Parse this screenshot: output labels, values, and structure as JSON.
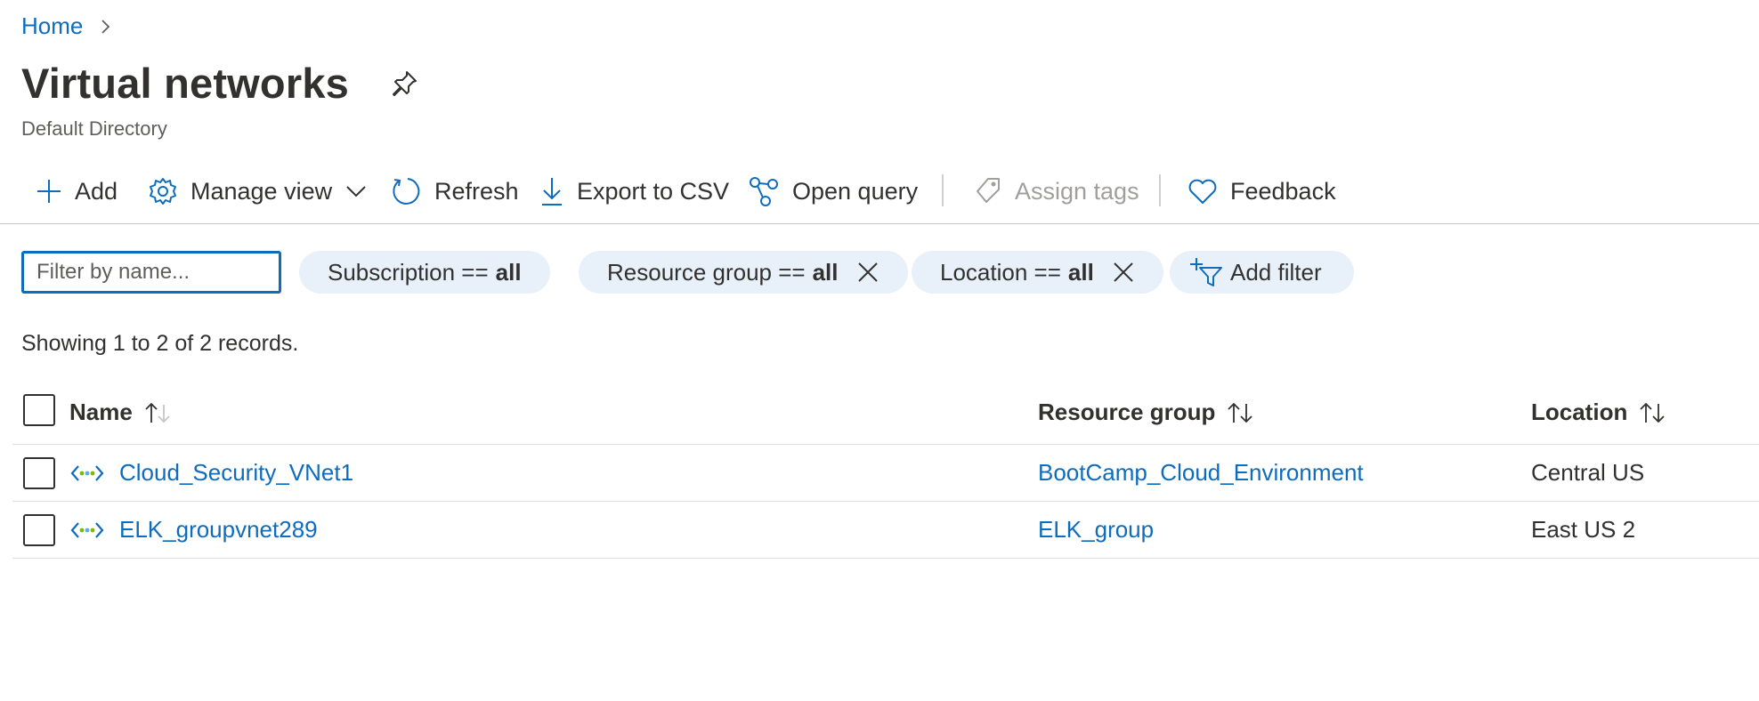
{
  "breadcrumb": {
    "home": "Home"
  },
  "page": {
    "title": "Virtual networks",
    "subtitle": "Default Directory"
  },
  "toolbar": {
    "add": "Add",
    "manage_view": "Manage view",
    "refresh": "Refresh",
    "export_csv": "Export to CSV",
    "open_query": "Open query",
    "assign_tags": "Assign tags",
    "feedback": "Feedback"
  },
  "filters": {
    "search_placeholder": "Filter by name...",
    "subscription_label": "Subscription ==",
    "subscription_value": "all",
    "resource_group_label": "Resource group ==",
    "resource_group_value": "all",
    "location_label": "Location ==",
    "location_value": "all",
    "add_filter": "Add filter"
  },
  "records_text": "Showing 1 to 2 of 2 records.",
  "table": {
    "columns": {
      "name": "Name",
      "resource_group": "Resource group",
      "location": "Location"
    },
    "rows": [
      {
        "name": "Cloud_Security_VNet1",
        "resource_group": "BootCamp_Cloud_Environment",
        "location": "Central US"
      },
      {
        "name": "ELK_groupvnet289",
        "resource_group": "ELK_group",
        "location": "East US 2"
      }
    ]
  },
  "colors": {
    "accent": "#0f6cbd",
    "pill_bg": "#e8f1fa",
    "text": "#323130",
    "disabled": "#a19f9d"
  }
}
